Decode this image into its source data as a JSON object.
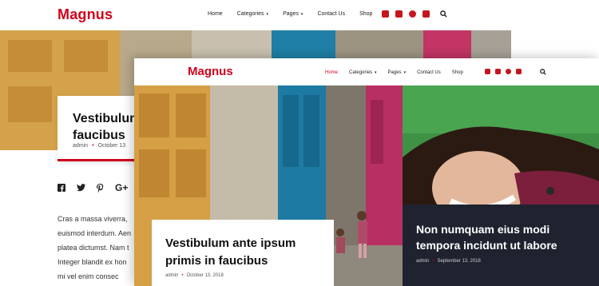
{
  "back_page": {
    "logo": "Magnus",
    "nav": [
      {
        "label": "Home",
        "has_dropdown": false
      },
      {
        "label": "Categories",
        "has_dropdown": true
      },
      {
        "label": "Pages",
        "has_dropdown": true
      },
      {
        "label": "Contact Us",
        "has_dropdown": false
      },
      {
        "label": "Shop",
        "has_dropdown": false
      }
    ],
    "social_icons": [
      "facebook-icon",
      "twitter-icon",
      "instagram-icon",
      "youtube-icon"
    ],
    "post": {
      "title_line1": "Vestibulum",
      "title_line2": "faucibus",
      "author": "admin",
      "date": "October 13"
    },
    "share_labels": [
      "G+"
    ],
    "body_lines": [
      "Cras a massa viverra,",
      "euismod interdum. Aen",
      "platea dictumst. Nam t",
      "Integer blandit ex hon",
      "mi vel enim consec"
    ]
  },
  "front_page": {
    "logo": "Magnus",
    "nav": [
      {
        "label": "Home",
        "has_dropdown": false,
        "active": true
      },
      {
        "label": "Categories",
        "has_dropdown": true
      },
      {
        "label": "Pages",
        "has_dropdown": true
      },
      {
        "label": "Contact Us",
        "has_dropdown": false
      },
      {
        "label": "Shop",
        "has_dropdown": false
      }
    ],
    "social_icons": [
      "facebook-icon",
      "twitter-icon",
      "instagram-icon",
      "youtube-icon"
    ],
    "posts": [
      {
        "title": "Vestibulum ante ipsum primis in faucibus",
        "author": "admin",
        "date": "October 13, 2018"
      },
      {
        "title": "Non numquam eius modi tempora incidunt ut labore",
        "author": "admin",
        "date": "September 13, 2018"
      }
    ]
  },
  "colors": {
    "accent": "#d0021b",
    "dark_card": "#1f2330"
  },
  "caret_glyph": "▾",
  "meta_separator": "•"
}
